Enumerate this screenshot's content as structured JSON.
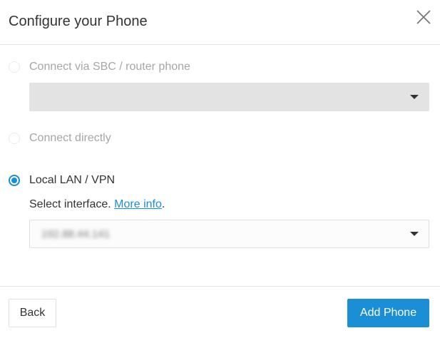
{
  "dialog": {
    "title": "Configure your Phone"
  },
  "options": {
    "sbc": {
      "label": "Connect via SBC / router phone",
      "checked": false,
      "select_value": ""
    },
    "direct": {
      "label": "Connect directly",
      "checked": false
    },
    "lan": {
      "label": "Local LAN / VPN",
      "checked": true,
      "hint_prefix": "Select interface. ",
      "hint_link": "More info",
      "hint_suffix": ".",
      "select_value": "192.88.44.141"
    }
  },
  "footer": {
    "back_label": "Back",
    "add_label": "Add Phone"
  },
  "colors": {
    "accent": "#1a8fd6",
    "disabled_text": "#a6a6a6",
    "disabled_select": "#e3e3e3"
  },
  "icons": {
    "close": "close-icon",
    "caret": "chevron-down-icon"
  }
}
